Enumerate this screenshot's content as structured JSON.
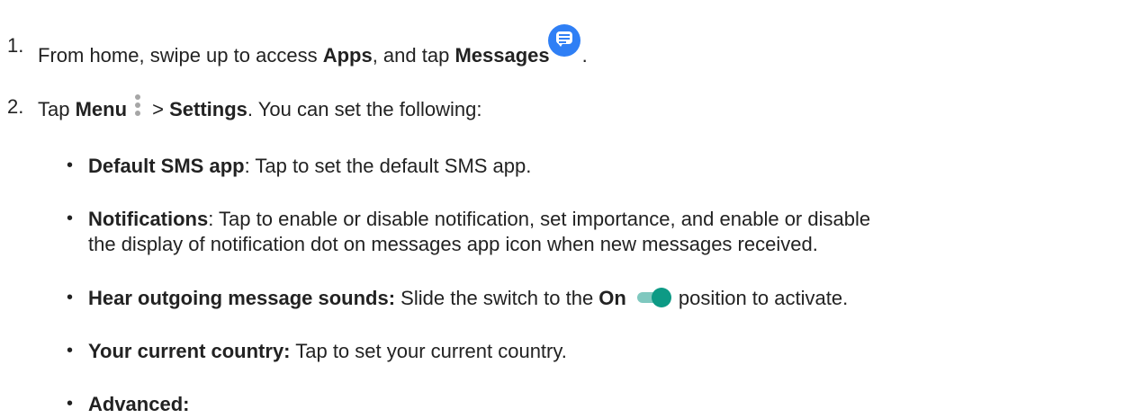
{
  "steps": [
    {
      "number": "1.",
      "prefix": "From home, swipe up to access ",
      "bold1": "Apps",
      "middle": ", and tap ",
      "bold2": "Messages",
      "suffix": "."
    },
    {
      "number": "2.",
      "prefix": "Tap ",
      "bold1": "Menu",
      "middle": " > ",
      "bold2": "Settings",
      "suffix": ". You can set the following:"
    }
  ],
  "settings": [
    {
      "bullet": "•",
      "term": "Default SMS app",
      "description": ": Tap to set the default SMS app."
    },
    {
      "bullet": "•",
      "term": "Notifications",
      "description_line1": ": Tap to enable or disable notification, set importance, and enable or disable",
      "description_line2": "the display of notification dot on messages app icon when new messages received."
    },
    {
      "bullet": "•",
      "term": "Hear outgoing message sounds:",
      "middle": " Slide the switch to the ",
      "bold": "On",
      "suffix": "position to activate."
    },
    {
      "bullet": "•",
      "term": "Your current country:",
      "description": " Tap to set your current country."
    },
    {
      "bullet": "•",
      "term": "Advanced:",
      "description": ""
    }
  ],
  "icons": {
    "messages": "messages-app-icon",
    "menu": "kebab-menu-icon",
    "toggle": "toggle-on-icon"
  },
  "colors": {
    "messages_icon": "#2f7ff5",
    "menu_icon": "#a6a6a6",
    "toggle_track": "#7fc8bf",
    "toggle_knob": "#0d9a85"
  }
}
